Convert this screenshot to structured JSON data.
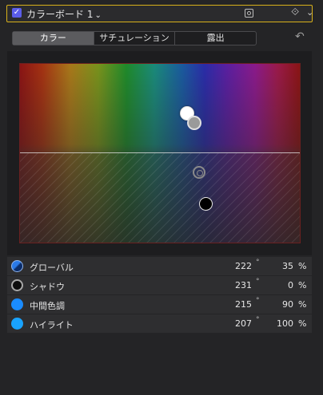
{
  "header": {
    "checked": true,
    "title": "カラーボード 1"
  },
  "tabs": [
    {
      "label": "カラー",
      "active": true
    },
    {
      "label": "サチュレーション",
      "active": false
    },
    {
      "label": "露出",
      "active": false
    }
  ],
  "rows": [
    {
      "label": "グローバル",
      "angle": "222",
      "percent": "35",
      "color": "#2a7ae8"
    },
    {
      "label": "シャドウ",
      "angle": "231",
      "percent": "0",
      "color": "#0d0d0d"
    },
    {
      "label": "中間色調",
      "angle": "215",
      "percent": "90",
      "color": "#1a8cff"
    },
    {
      "label": "ハイライト",
      "angle": "207",
      "percent": "100",
      "color": "#19a3ff"
    }
  ],
  "units": {
    "degree": "°",
    "percent": "%"
  },
  "colors": {
    "accent_border": "#d8b11a",
    "checkbox": "#5b5de8"
  }
}
